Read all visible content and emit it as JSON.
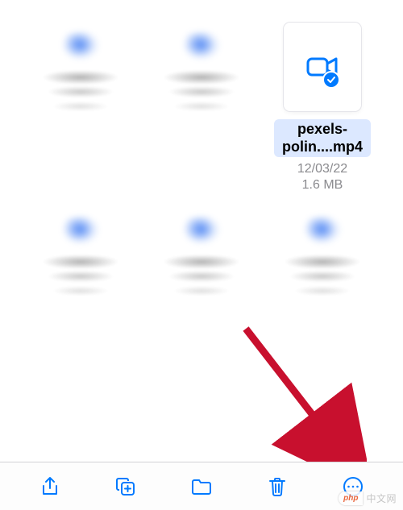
{
  "files": [
    {
      "blurred": true
    },
    {
      "blurred": true
    },
    {
      "blurred": false,
      "selected": true,
      "name": "pexels-polin....mp4",
      "date": "12/03/22",
      "size": "1.6 MB"
    },
    {
      "blurred": true
    },
    {
      "blurred": true
    },
    {
      "blurred": true
    }
  ],
  "toolbar": {
    "share": "share-icon",
    "duplicate": "duplicate-icon",
    "folder": "folder-icon",
    "delete": "trash-icon",
    "more": "more-icon"
  },
  "colors": {
    "accent": "#007aff",
    "muted": "#8a8a8e",
    "arrow": "#c8102e"
  },
  "watermark": {
    "badge": "php",
    "text": "中文网"
  }
}
